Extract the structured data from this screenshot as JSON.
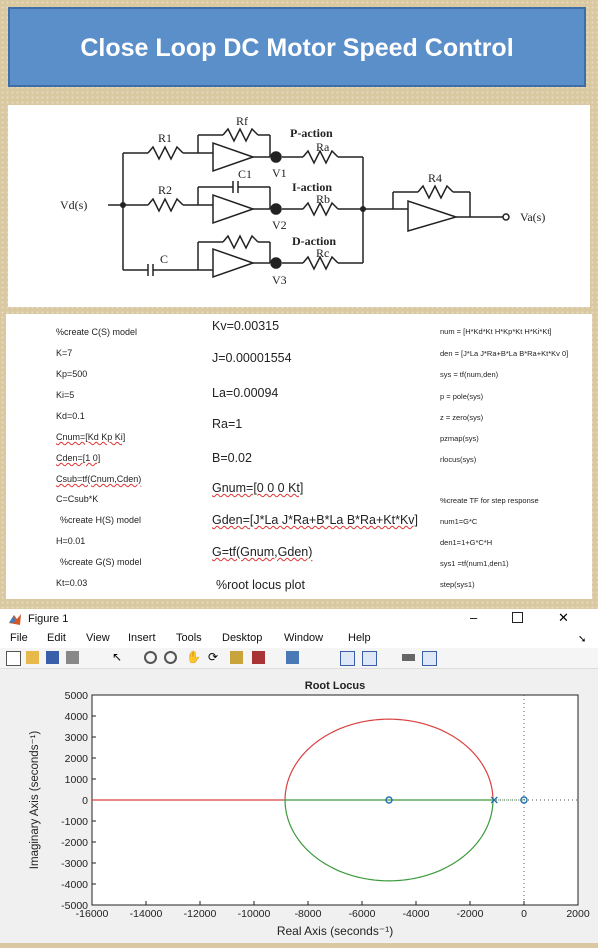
{
  "banner": {
    "title": "Close Loop DC Motor Speed Control"
  },
  "circuit": {
    "labels": {
      "rf": "Rf",
      "r1": "R1",
      "r2": "R2",
      "c1": "C1",
      "c": "C",
      "ra": "Ra",
      "rb": "Rb",
      "rc": "Rc",
      "r4": "R4",
      "v1": "V1",
      "v2": "V2",
      "v3": "V3",
      "p_action": "P-action",
      "i_action": "I-action",
      "d_action": "D-action",
      "vd": "Vd(s)",
      "va": "Va(s)"
    }
  },
  "code": {
    "col1": [
      "%create C(S) model",
      "K=7",
      "Kp=500",
      "Ki=5",
      "Kd=0.1",
      "Cnum=[Kd Kp Ki]",
      "Cden=[1 0]",
      "Csub=tf(Cnum,Cden)",
      "C=Csub*K",
      "%create H(S) model",
      "H=0.01",
      "%create G(S) model",
      "Kt=0.03"
    ],
    "col2": [
      "Kv=0.00315",
      "J=0.00001554",
      "La=0.00094",
      "Ra=1",
      "B=0.02",
      "Gnum=[0 0 0 Kt]",
      "Gden=[J*La J*Ra+B*La B*Ra+Kt*Kv]",
      "G=tf(Gnum,Gden)",
      "%root locus plot"
    ],
    "col3": [
      "num = [H*Kd*Kt H*Kp*Kt H*Ki*Kt]",
      "den = [J*La J*Ra+B*La B*Ra+Kt*Kv 0]",
      "sys = tf(num,den)",
      "p = pole(sys)",
      "z = zero(sys)",
      "pzmap(sys)",
      "rlocus(sys)",
      "%create TF for step response",
      "num1=G*C",
      "den1=1+G*C*H",
      "sys1 =tf(num1,den1)",
      "step(sys1)"
    ]
  },
  "figure": {
    "window_title": "Figure 1",
    "menu": [
      "File",
      "Edit",
      "View",
      "Insert",
      "Tools",
      "Desktop",
      "Window",
      "Help"
    ],
    "toolbar_icons": [
      "new-figure-icon",
      "open-file-icon",
      "save-icon",
      "print-icon",
      "pointer-icon",
      "zoom-in-icon",
      "zoom-out-icon",
      "pan-icon",
      "rotate-icon",
      "data-cursor-icon",
      "brush-icon",
      "link-icon",
      "colorbar-icon",
      "legend-icon",
      "hide-plot-tools-icon",
      "show-plot-tools-icon"
    ]
  },
  "chart_data": {
    "type": "line",
    "title": "Root Locus",
    "xlabel": "Real Axis (seconds⁻¹)",
    "ylabel": "Imaginary Axis (seconds⁻¹)",
    "xlim": [
      -16000,
      2000
    ],
    "ylim": [
      -5000,
      5000
    ],
    "xticks": [
      -16000,
      -14000,
      -12000,
      -10000,
      -8000,
      -6000,
      -4000,
      -2000,
      0,
      2000
    ],
    "yticks": [
      -5000,
      -4000,
      -3000,
      -2000,
      -1000,
      0,
      1000,
      2000,
      3000,
      4000,
      5000
    ],
    "grid": false,
    "series": [
      {
        "color": "#d94040",
        "points": [
          [
            -16000,
            0
          ],
          [
            -8900,
            0
          ]
        ]
      },
      {
        "color": "#d94040",
        "circle": {
          "cx": -5000,
          "cy": 0,
          "r": 3850
        },
        "half": "upper"
      },
      {
        "color": "#3a9a3a",
        "circle": {
          "cx": -5000,
          "cy": 0,
          "r": 3850
        },
        "half": "lower"
      },
      {
        "color": "#3a9a3a",
        "points": [
          [
            -8900,
            0
          ],
          [
            -1100,
            0
          ]
        ]
      },
      {
        "color": "#3a9a3a",
        "points": [
          [
            -1100,
            0
          ],
          [
            0,
            0
          ]
        ],
        "style": "dotted"
      }
    ],
    "zeros": [
      [
        -5000,
        0
      ],
      [
        0,
        0
      ]
    ],
    "poles": [
      [
        -1100,
        0
      ]
    ]
  }
}
